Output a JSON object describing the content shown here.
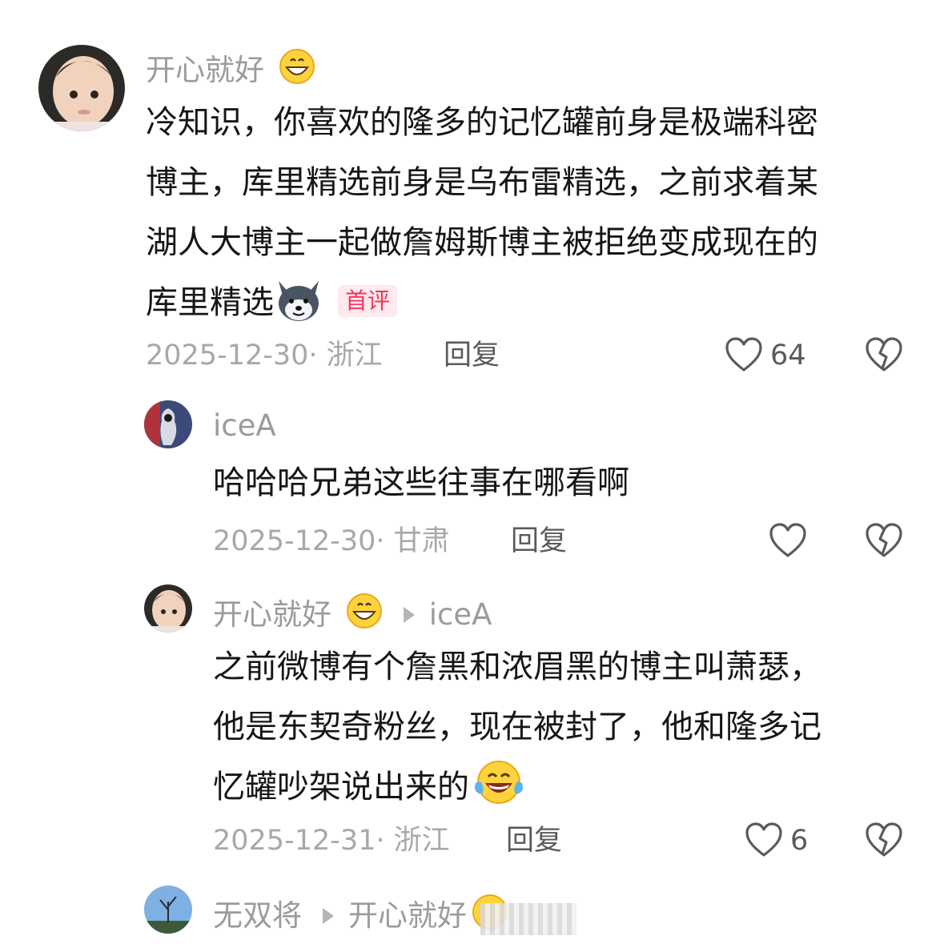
{
  "comments": [
    {
      "user": "开心就好",
      "text_lines": [
        "冷知识，你喜欢的隆多的记忆罐前身是极端科密",
        "博主，库里精选前身是乌布雷精选，之前求着某",
        "湖人大博主一起做詹姆斯博主被拒绝变成现在的",
        "库里精选"
      ],
      "badge": "首评",
      "date": "2025-12-30",
      "location": "浙江",
      "reply_label": "回复",
      "likes": "64"
    },
    {
      "user": "iceA",
      "text_lines": [
        "哈哈哈兄弟这些往事在哪看啊"
      ],
      "date": "2025-12-30",
      "location": "甘肃",
      "reply_label": "回复",
      "likes": ""
    },
    {
      "user": "开心就好",
      "reply_to": "iceA",
      "text_lines": [
        "之前微博有个詹黑和浓眉黑的博主叫萧瑟，",
        "他是东契奇粉丝，现在被封了，他和隆多记",
        "忆罐吵架说出来的"
      ],
      "date": "2025-12-31",
      "location": "浙江",
      "reply_label": "回复",
      "likes": "6"
    },
    {
      "user": "无双将",
      "reply_to": "开心就好"
    }
  ],
  "icons": {
    "like": "heart-outline-icon",
    "dislike": "broken-heart-icon",
    "reply_arrow": "triangle-right-icon",
    "emoji_grin": "grinning-face-emoji",
    "emoji_husky": "husky-sticker-emoji",
    "emoji_laugh": "tears-of-joy-emoji"
  },
  "colors": {
    "badge_text": "#f2355b",
    "badge_bg": "#fde9ee",
    "meta": "#a8a8a8"
  }
}
